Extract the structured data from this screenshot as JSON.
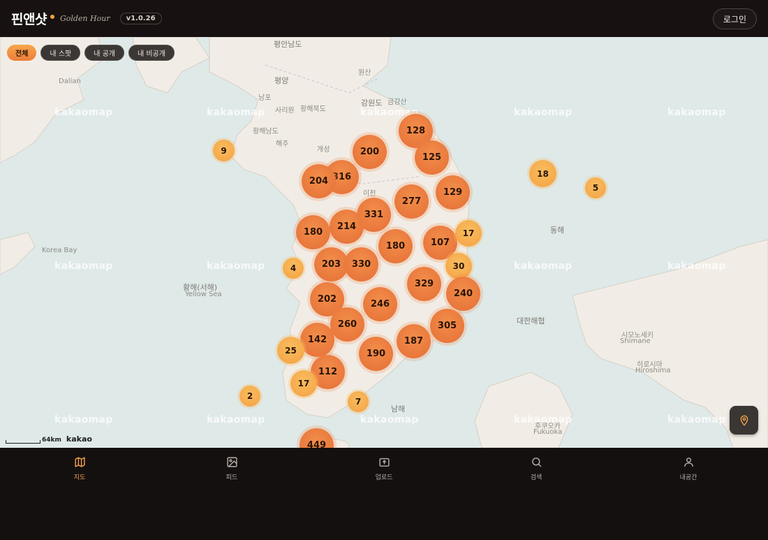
{
  "header": {
    "brand_title": "핀앤샷",
    "brand_subtitle": "Golden Hour",
    "version": "v1.0.26",
    "login_label": "로그인"
  },
  "filters": [
    {
      "label": "전체",
      "active": true
    },
    {
      "label": "내 스팟",
      "active": false
    },
    {
      "label": "내 공개",
      "active": false
    },
    {
      "label": "내 비공개",
      "active": false
    }
  ],
  "map": {
    "watermark": "kakaomap",
    "scale_label": "64km",
    "attribution": "kakao",
    "places": [
      "평안남도",
      "평양",
      "남포",
      "사리원",
      "황해북도",
      "황해남도",
      "해주",
      "개성",
      "원산",
      "강원도",
      "금강산",
      "이천",
      "황해(서해)",
      "동해",
      "대한해협",
      "시모노세키",
      "후쿠오카",
      "히로시마",
      "남해",
      "Dalian",
      "Korea Bay",
      "Yellow Sea",
      "Shimane",
      "Fukuoka",
      "Hiroshima"
    ],
    "clusters": [
      "9",
      "128",
      "200",
      "125",
      "204",
      "316",
      "18",
      "5",
      "129",
      "277",
      "331",
      "214",
      "180",
      "180",
      "107",
      "17",
      "4",
      "203",
      "330",
      "30",
      "329",
      "240",
      "202",
      "246",
      "260",
      "305",
      "142",
      "187",
      "25",
      "190",
      "112",
      "17",
      "2",
      "7",
      "449"
    ]
  },
  "nav": [
    {
      "label": "지도",
      "icon": "map-icon",
      "active": true
    },
    {
      "label": "피드",
      "icon": "image-icon",
      "active": false
    },
    {
      "label": "업로드",
      "icon": "upload-icon",
      "active": false
    },
    {
      "label": "검색",
      "icon": "search-icon",
      "active": false
    },
    {
      "label": "내공간",
      "icon": "user-icon",
      "active": false
    }
  ],
  "colors": {
    "accent": "#f2a44a",
    "cluster_big": "#e9773c",
    "cluster_small": "#f6b050",
    "background": "#151010",
    "sea": "#dfe9e8",
    "land": "#f1ede6"
  }
}
